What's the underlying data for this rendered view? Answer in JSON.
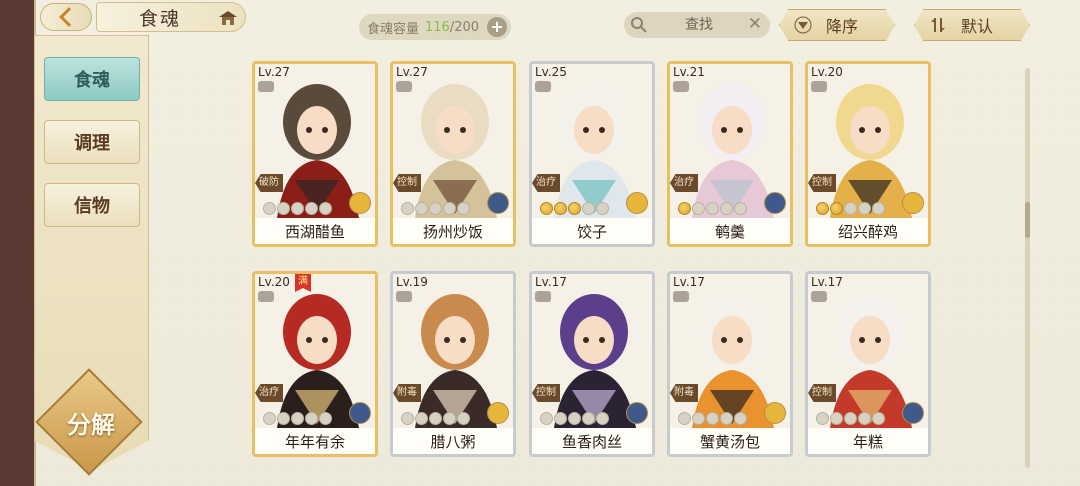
{
  "header": {
    "title": "食魂",
    "capacity_label": "食魂容量",
    "capacity_count": "116",
    "capacity_total": "/200",
    "search_placeholder": "查找",
    "sort_desc_label": "降序",
    "sort_default_label": "默认"
  },
  "sidebar": {
    "tabs": [
      {
        "label": "食魂"
      },
      {
        "label": "调理"
      },
      {
        "label": "信物"
      }
    ],
    "decompose_label": "分解"
  },
  "colors": {
    "gold_frame": "#e8c064",
    "silver_frame": "#c7cbd0",
    "active_tab": "#8ccac3",
    "capacity_green": "#8bbf3a"
  },
  "cards": [
    {
      "level": "Lv.27",
      "name": "西湖醋鱼",
      "role": "破防",
      "frame": "gold",
      "stars_lit": 0,
      "palette": [
        "#5a4a3c",
        "#8b1f18",
        "#2d2624"
      ]
    },
    {
      "level": "Lv.27",
      "name": "扬州炒饭",
      "role": "控制",
      "frame": "gold",
      "stars_lit": 0,
      "palette": [
        "#e9dcc2",
        "#d4c29a",
        "#6b4a30"
      ]
    },
    {
      "level": "Lv.25",
      "name": "饺子",
      "role": "治疗",
      "frame": "silver",
      "stars_lit": 3,
      "palette": [
        "#f3f1ea",
        "#dfe6ec",
        "#6fbfbf"
      ]
    },
    {
      "level": "Lv.21",
      "name": "鹌羹",
      "role": "治疗",
      "frame": "gold",
      "stars_lit": 1,
      "palette": [
        "#f2eef2",
        "#e7c8d6",
        "#b7c2cf"
      ]
    },
    {
      "level": "Lv.20",
      "name": "绍兴醉鸡",
      "role": "控制",
      "frame": "gold",
      "stars_lit": 2,
      "palette": [
        "#f0d98f",
        "#e3b04a",
        "#2b2420"
      ]
    },
    {
      "level": "Lv.20",
      "name": "年年有余",
      "role": "治疗",
      "frame": "gold",
      "stars_lit": 0,
      "palette": [
        "#b52a22",
        "#2a1f1c",
        "#e6c27a"
      ],
      "ribbon": "满"
    },
    {
      "level": "Lv.19",
      "name": "腊八粥",
      "role": "附毒",
      "frame": "silver",
      "stars_lit": 0,
      "palette": [
        "#c98a4e",
        "#3a2b28",
        "#e8d8c2"
      ]
    },
    {
      "level": "Lv.17",
      "name": "鱼香肉丝",
      "role": "控制",
      "frame": "silver",
      "stars_lit": 0,
      "palette": [
        "#5b3f8a",
        "#2b2233",
        "#c7b4d8"
      ]
    },
    {
      "level": "Lv.17",
      "name": "蟹黄汤包",
      "role": "附毒",
      "frame": "silver",
      "stars_lit": 0,
      "palette": [
        "#f4f1ea",
        "#e9922e",
        "#2b2420"
      ]
    },
    {
      "level": "Lv.17",
      "name": "年糕",
      "role": "控制",
      "frame": "silver",
      "stars_lit": 0,
      "palette": [
        "#f5f1ec",
        "#c33a2a",
        "#e6bc74"
      ]
    }
  ]
}
